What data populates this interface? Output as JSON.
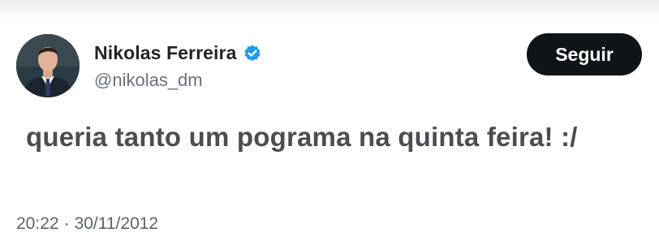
{
  "tweet": {
    "author": {
      "display_name": "Nikolas Ferreira",
      "handle": "@nikolas_dm",
      "verified": true,
      "verified_color": "#1d9bf0"
    },
    "follow_button_label": "Seguir",
    "text": "queria tanto um pograma na quinta feira! :/",
    "time": "20:22",
    "separator": "·",
    "date": "30/11/2012"
  },
  "colors": {
    "follow_button_bg": "#0f1419",
    "text": "#4a4d51",
    "secondary_text": "#6b7178"
  },
  "icons": {
    "avatar": "avatar-photo",
    "verified": "verified-badge-icon"
  }
}
